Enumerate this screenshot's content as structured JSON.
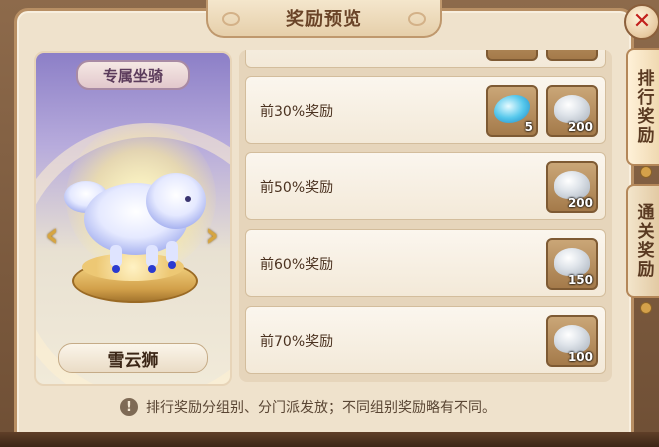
{
  "dialog": {
    "title": "奖励预览"
  },
  "side_tabs": [
    {
      "label": "排行奖励",
      "active": true
    },
    {
      "label": "通关奖励",
      "active": false
    }
  ],
  "mount": {
    "tag": "专属坐骑",
    "name": "雪云狮"
  },
  "rewards": [
    {
      "label": "前30%奖励",
      "items": [
        {
          "icon": "blue-feather-icon",
          "qty": "5"
        },
        {
          "icon": "silver-pile-icon",
          "qty": "200"
        }
      ]
    },
    {
      "label": "前50%奖励",
      "items": [
        {
          "icon": "silver-pile-icon",
          "qty": "200"
        }
      ]
    },
    {
      "label": "前60%奖励",
      "items": [
        {
          "icon": "silver-pile-icon",
          "qty": "150"
        }
      ]
    },
    {
      "label": "前70%奖励",
      "items": [
        {
          "icon": "silver-pile-icon",
          "qty": "100"
        }
      ]
    }
  ],
  "footnote": {
    "text": "排行奖励分组别、分门派发放；不同组别奖励略有不同。"
  },
  "colors": {
    "panel": "#efe2cc",
    "accent_close": "#c2201c",
    "text_dark": "#4b3220"
  }
}
